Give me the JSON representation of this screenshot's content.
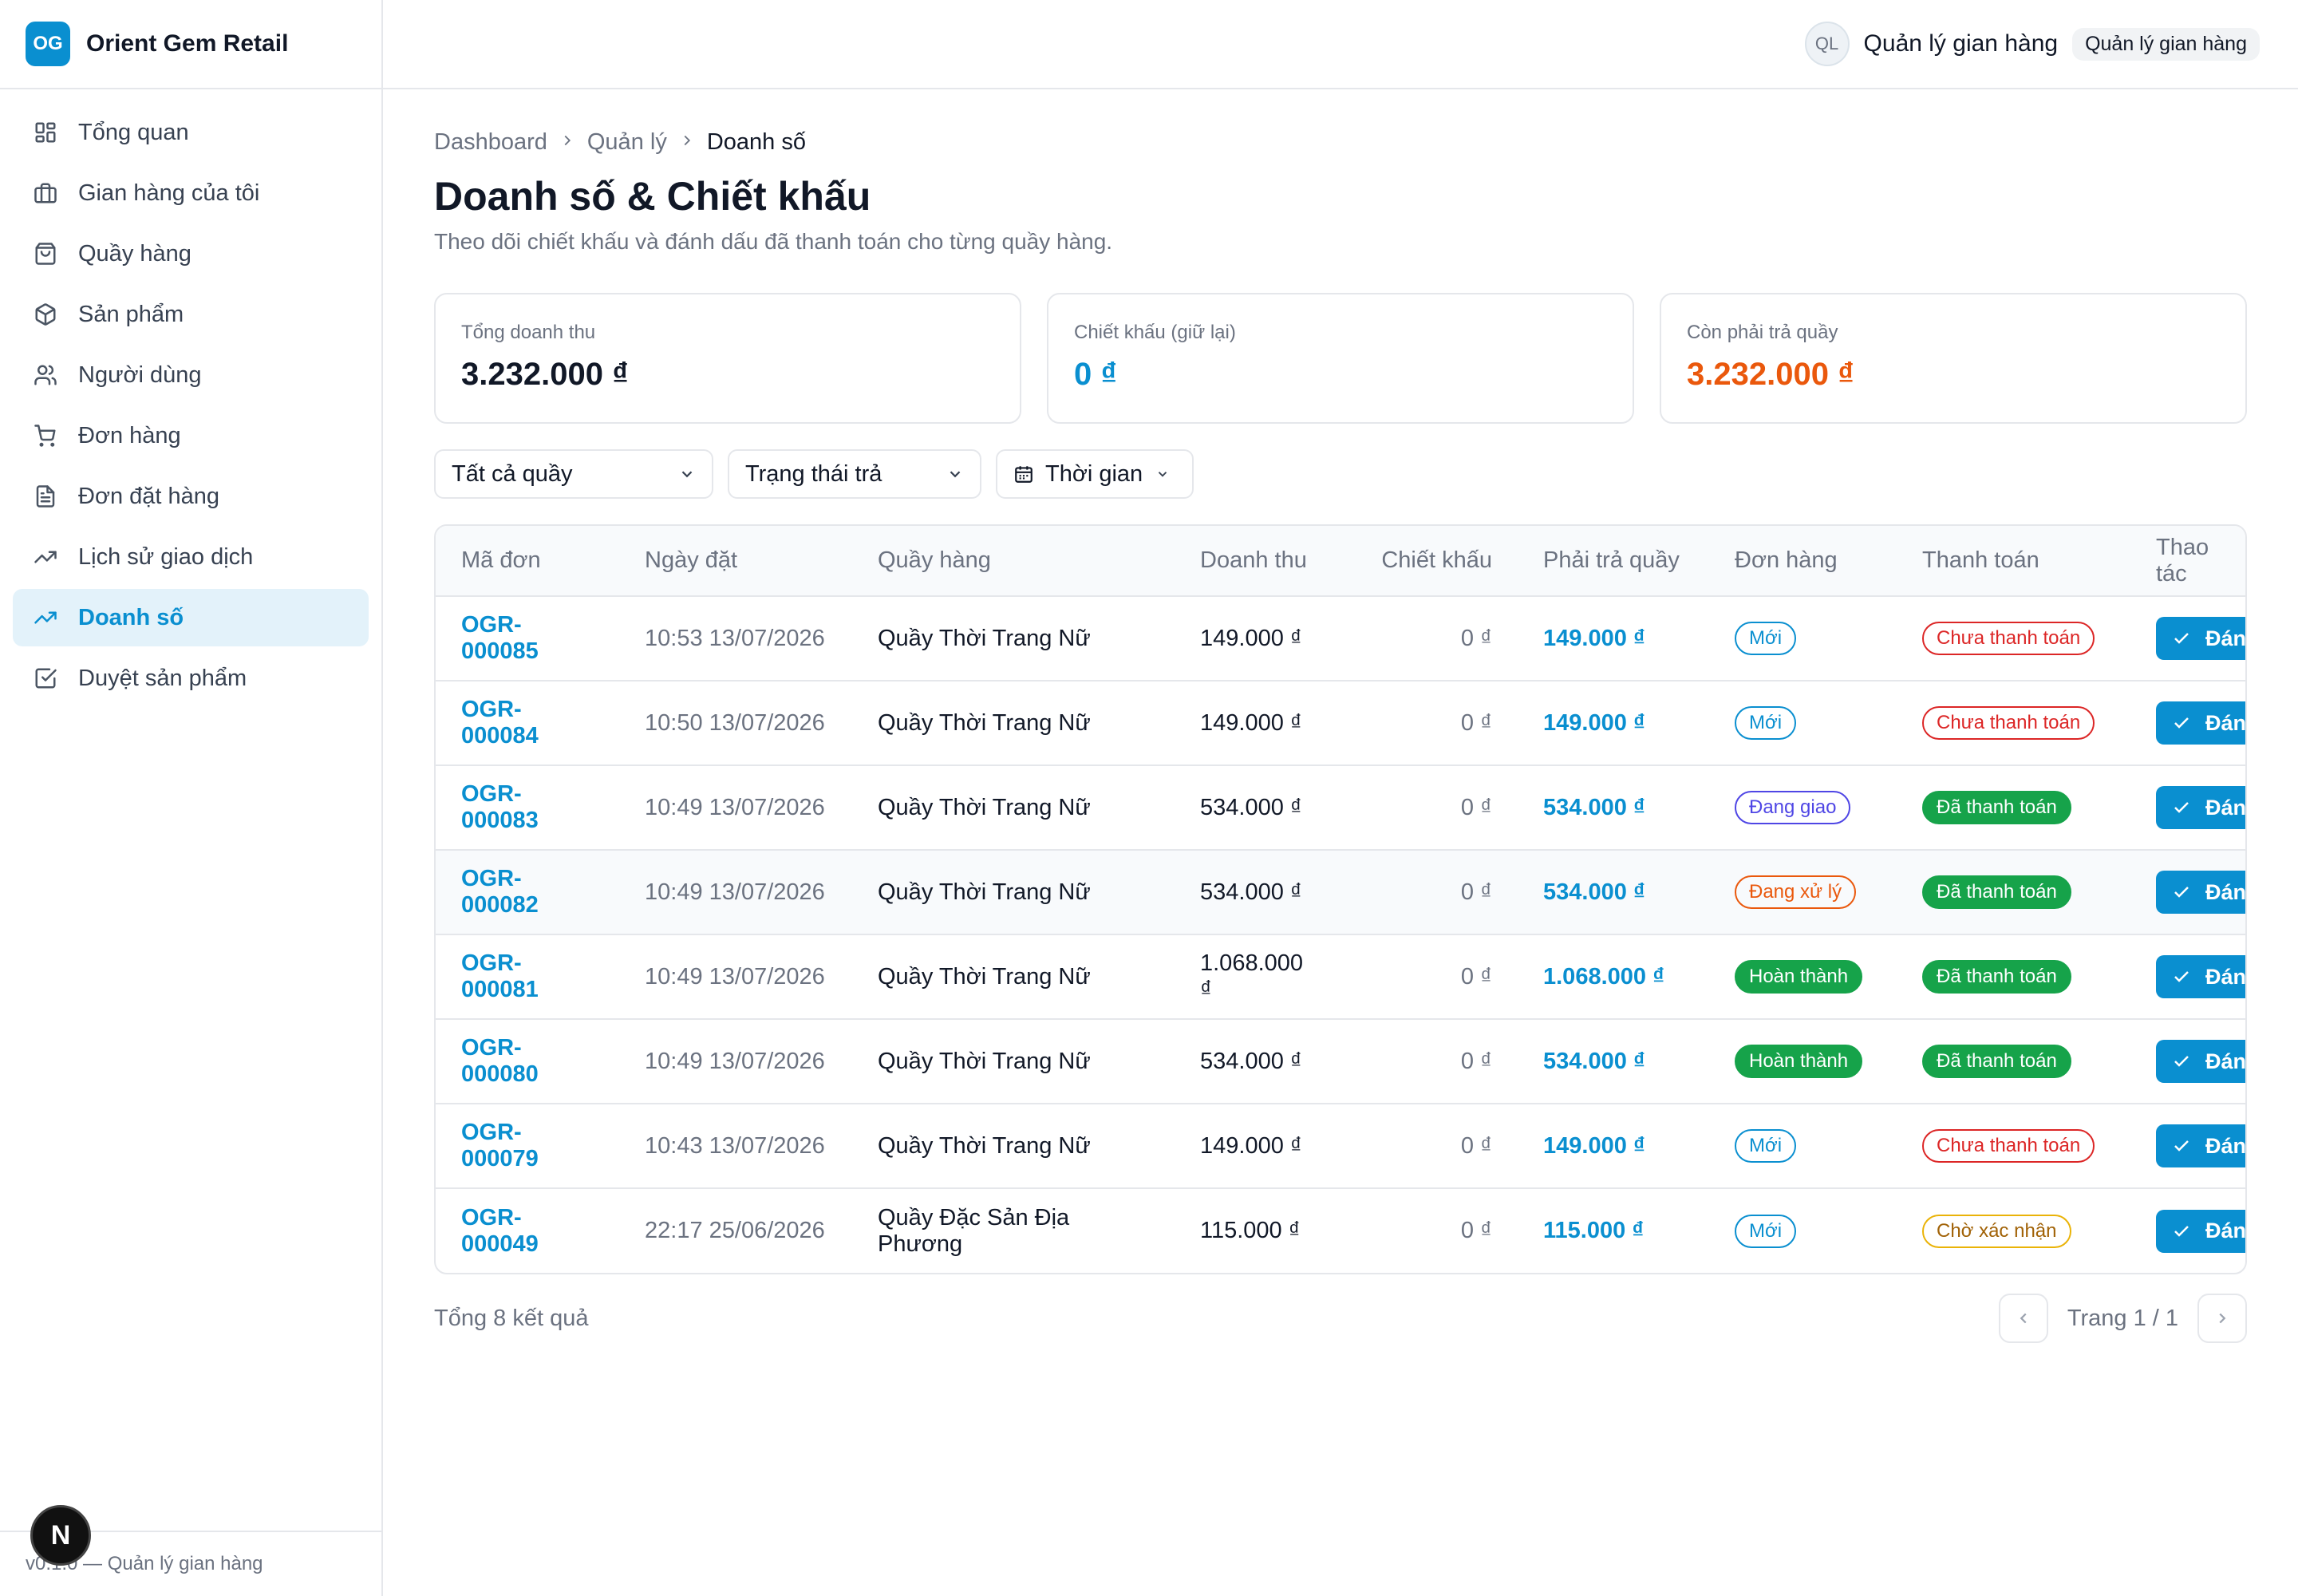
{
  "brand": {
    "logo": "OG",
    "name": "Orient Gem Retail"
  },
  "topbar": {
    "avatar": "QL",
    "user_name": "Quản lý gian hàng",
    "role": "Quản lý gian hàng"
  },
  "nav": [
    {
      "label": "Tổng quan",
      "icon": "dashboard-icon",
      "active": false
    },
    {
      "label": "Gian hàng của tôi",
      "icon": "briefcase-icon",
      "active": false
    },
    {
      "label": "Quầy hàng",
      "icon": "shopping-bag-icon",
      "active": false
    },
    {
      "label": "Sản phẩm",
      "icon": "package-icon",
      "active": false
    },
    {
      "label": "Người dùng",
      "icon": "users-icon",
      "active": false
    },
    {
      "label": "Đơn hàng",
      "icon": "cart-icon",
      "active": false
    },
    {
      "label": "Đơn đặt hàng",
      "icon": "file-text-icon",
      "active": false
    },
    {
      "label": "Lịch sử giao dịch",
      "icon": "trend-icon",
      "active": false
    },
    {
      "label": "Doanh số",
      "icon": "trend-icon",
      "active": true
    },
    {
      "label": "Duyệt sản phẩm",
      "icon": "check-square-icon",
      "active": false
    }
  ],
  "footer": {
    "text": "v0.1.0 — Quản lý gian hàng",
    "dev_badge": "N"
  },
  "breadcrumb": {
    "items": [
      "Dashboard",
      "Quản lý"
    ],
    "current": "Doanh số"
  },
  "page": {
    "title": "Doanh số & Chiết khấu",
    "subtitle": "Theo dõi chiết khấu và đánh dấu đã thanh toán cho từng quầy hàng."
  },
  "stats": [
    {
      "label": "Tổng doanh thu",
      "value": "3.232.000 ₫",
      "color": "#111827"
    },
    {
      "label": "Chiết khấu (giữ lại)",
      "value": "0 ₫",
      "color": "#0a8fd0"
    },
    {
      "label": "Còn phải trả quầy",
      "value": "3.232.000 ₫",
      "color": "#ea580c"
    }
  ],
  "filters": {
    "counter": "Tất cả quầy",
    "status": "Trạng thái trả",
    "time": "Thời gian"
  },
  "table": {
    "headers": [
      "Mã đơn",
      "Ngày đặt",
      "Quầy hàng",
      "Doanh thu",
      "Chiết khấu",
      "Phải trả quầy",
      "Đơn hàng",
      "Thanh toán",
      "Thao tác"
    ],
    "action_label": "Đánh dấu",
    "rows": [
      {
        "code": "OGR-000085",
        "date": "10:53 13/07/2026",
        "counter": "Quầy Thời Trang Nữ",
        "revenue": "149.000 ₫",
        "discount": "0 ₫",
        "payable": "149.000 ₫",
        "order": "Mới",
        "order_kind": "new",
        "payment": "Chưa thanh toán",
        "payment_kind": "unpaid"
      },
      {
        "code": "OGR-000084",
        "date": "10:50 13/07/2026",
        "counter": "Quầy Thời Trang Nữ",
        "revenue": "149.000 ₫",
        "discount": "0 ₫",
        "payable": "149.000 ₫",
        "order": "Mới",
        "order_kind": "new",
        "payment": "Chưa thanh toán",
        "payment_kind": "unpaid"
      },
      {
        "code": "OGR-000083",
        "date": "10:49 13/07/2026",
        "counter": "Quầy Thời Trang Nữ",
        "revenue": "534.000 ₫",
        "discount": "0 ₫",
        "payable": "534.000 ₫",
        "order": "Đang giao",
        "order_kind": "ship",
        "payment": "Đã thanh toán",
        "payment_kind": "paid"
      },
      {
        "code": "OGR-000082",
        "date": "10:49 13/07/2026",
        "counter": "Quầy Thời Trang Nữ",
        "revenue": "534.000 ₫",
        "discount": "0 ₫",
        "payable": "534.000 ₫",
        "order": "Đang xử lý",
        "order_kind": "proc",
        "payment": "Đã thanh toán",
        "payment_kind": "paid"
      },
      {
        "code": "OGR-000081",
        "date": "10:49 13/07/2026",
        "counter": "Quầy Thời Trang Nữ",
        "revenue": "1.068.000 ₫",
        "discount": "0 ₫",
        "payable": "1.068.000 ₫",
        "order": "Hoàn thành",
        "order_kind": "done",
        "payment": "Đã thanh toán",
        "payment_kind": "paid"
      },
      {
        "code": "OGR-000080",
        "date": "10:49 13/07/2026",
        "counter": "Quầy Thời Trang Nữ",
        "revenue": "534.000 ₫",
        "discount": "0 ₫",
        "payable": "534.000 ₫",
        "order": "Hoàn thành",
        "order_kind": "done",
        "payment": "Đã thanh toán",
        "payment_kind": "paid"
      },
      {
        "code": "OGR-000079",
        "date": "10:43 13/07/2026",
        "counter": "Quầy Thời Trang Nữ",
        "revenue": "149.000 ₫",
        "discount": "0 ₫",
        "payable": "149.000 ₫",
        "order": "Mới",
        "order_kind": "new",
        "payment": "Chưa thanh toán",
        "payment_kind": "unpaid"
      },
      {
        "code": "OGR-000049",
        "date": "22:17 25/06/2026",
        "counter": "Quầy Đặc Sản Địa Phương",
        "revenue": "115.000 ₫",
        "discount": "0 ₫",
        "payable": "115.000 ₫",
        "order": "Mới",
        "order_kind": "new",
        "payment": "Chờ xác nhận",
        "payment_kind": "wait"
      }
    ]
  },
  "pager": {
    "total": "Tổng 8 kết quả",
    "page": "Trang 1 / 1"
  }
}
